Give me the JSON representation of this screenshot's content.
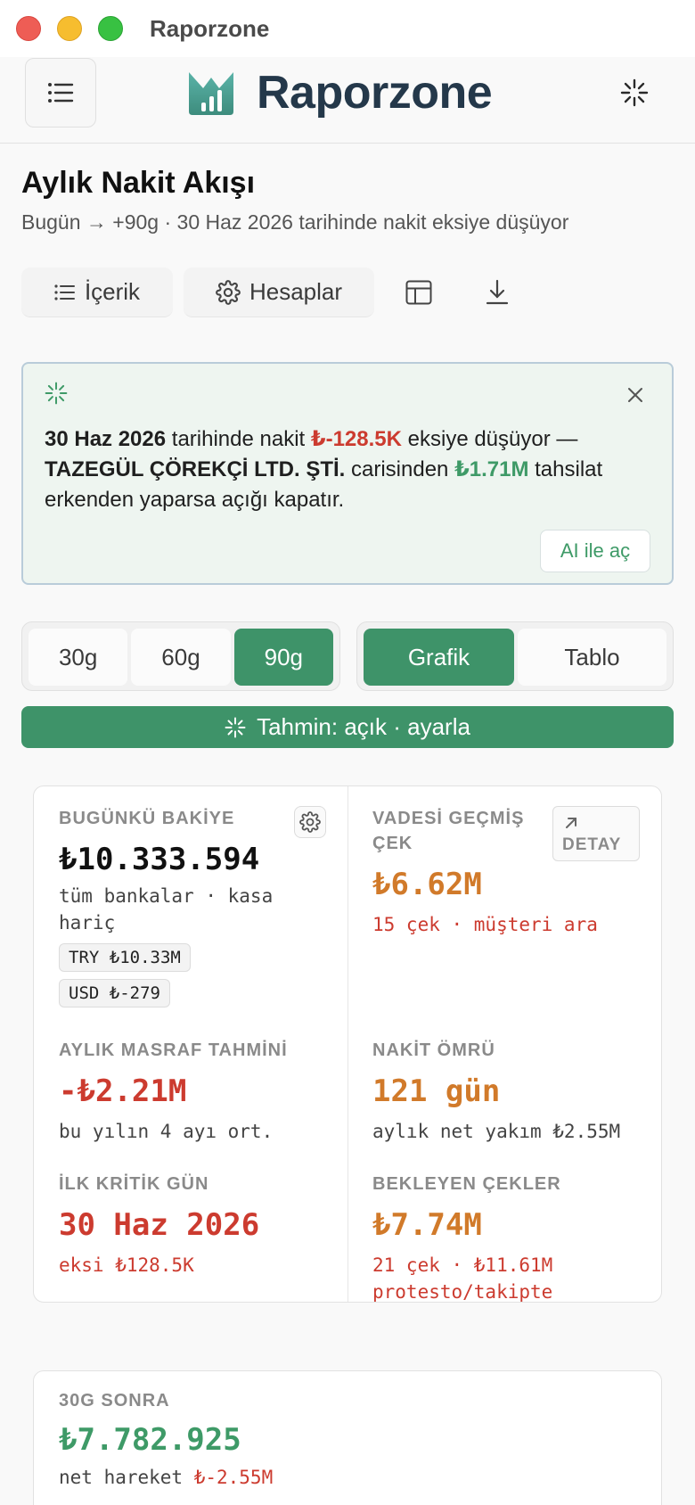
{
  "window": {
    "title": "Raporzone"
  },
  "header": {
    "brand": "Raporzone"
  },
  "page": {
    "title": "Aylık Nakit Akışı",
    "subtitle": "Bugün → +90g · 30 Haz 2026 tarihinde nakit eksiye düşüyor"
  },
  "toolbar": {
    "contents_label": "İçerik",
    "accounts_label": "Hesaplar"
  },
  "alert": {
    "date": "30 Haz 2026",
    "t1": " tarihinde nakit ",
    "deficit": "₺-128.5K",
    "t2": " eksiye düşüyor — ",
    "customer": "TAZEGÜL ÇÖREKÇİ LTD. ŞTİ.",
    "t3": " carisinden ",
    "amount": "₺1.71M",
    "t4": " tahsilat erkenden yaparsa açığı kapatır.",
    "button": "AI ile aç"
  },
  "range": {
    "options": [
      "30g",
      "60g",
      "90g"
    ],
    "selected": "90g"
  },
  "view": {
    "options": [
      "Grafik",
      "Tablo"
    ],
    "selected": "Grafik"
  },
  "forecast_label": "Tahmin: açık · ayarla",
  "kpis": {
    "balance": {
      "label": "BUGÜNKÜ BAKİYE",
      "value": "₺10.333.594",
      "sub": "tüm bankalar · kasa hariç",
      "chips": [
        "TRY ₺10.33M",
        "USD ₺-279"
      ]
    },
    "overdue": {
      "label": "VADESİ GEÇMİŞ ÇEK",
      "value": "₺6.62M",
      "sub": "15 çek · müşteri ara",
      "detail": "DETAY"
    },
    "expense": {
      "label": "AYLIK MASRAF TAHMİNİ",
      "value": "-₺2.21M",
      "sub": "bu yılın 4 ayı ort."
    },
    "runway": {
      "label": "NAKİT ÖMRÜ",
      "value": "121 gün",
      "sub": "aylık net yakım ₺2.55M"
    },
    "critical": {
      "label": "İLK KRİTİK GÜN",
      "value": "30 Haz 2026",
      "sub": "eksi ₺128.5K"
    },
    "pending": {
      "label": "BEKLEYEN ÇEKLER",
      "value": "₺7.74M",
      "sub1": "21 çek · ₺11.61M",
      "sub2": "protesto/takipte"
    }
  },
  "after30": {
    "label": "30G SONRA",
    "value": "₺7.782.925",
    "sub_prefix": "net hareket ",
    "sub_value": "₺-2.55M"
  },
  "colors": {
    "accent": "#3e9369",
    "negative": "#cc3b2f",
    "warning": "#d17a2a"
  }
}
